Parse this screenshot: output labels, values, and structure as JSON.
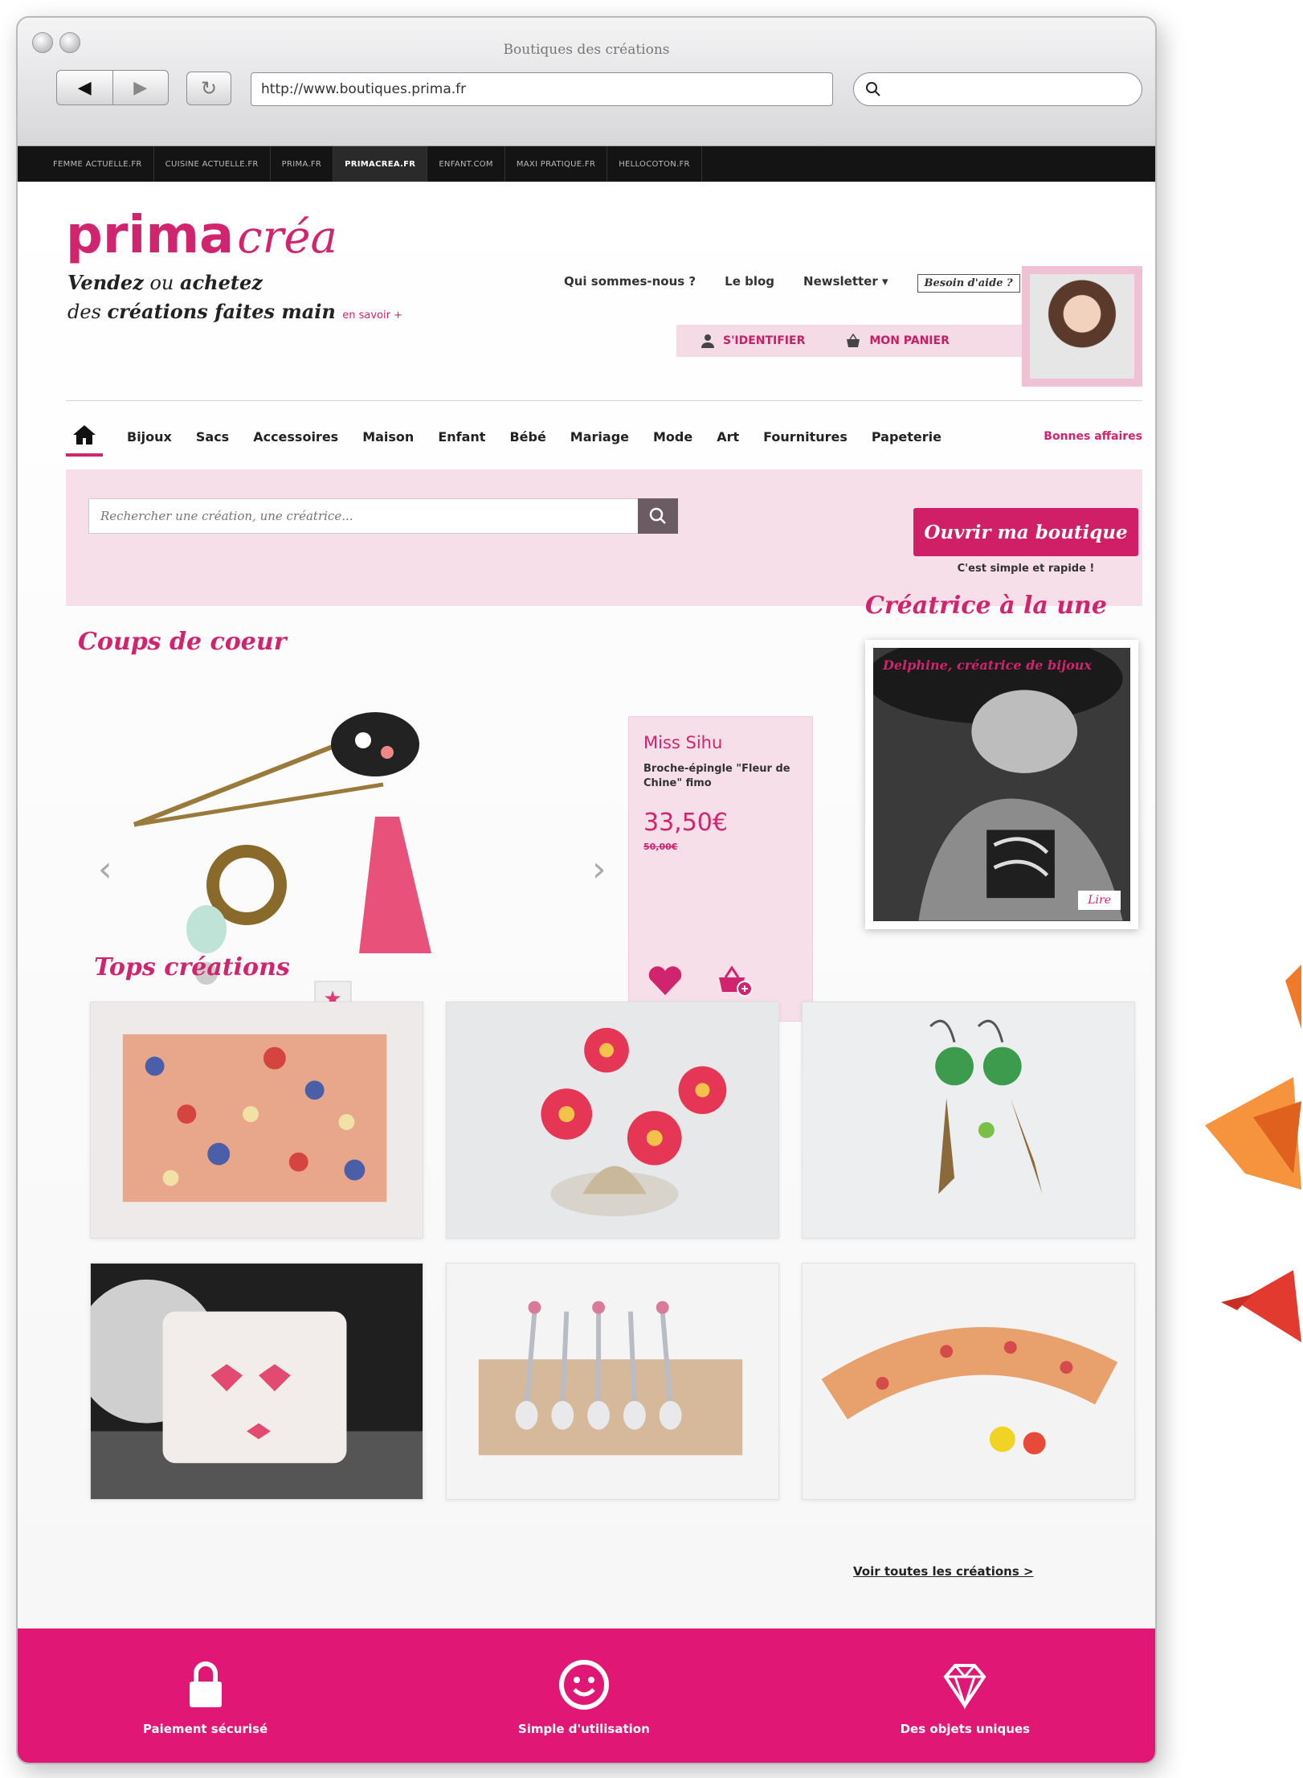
{
  "browser": {
    "window_title": "Boutiques des créations",
    "url": "http://www.boutiques.prima.fr",
    "back_icon": "back-arrow-icon",
    "forward_icon": "forward-arrow-icon",
    "reload_icon": "reload-icon",
    "search_icon": "search-icon"
  },
  "network_bar": {
    "items": [
      "FEMME ACTUELLE.FR",
      "CUISINE ACTUELLE.FR",
      "PRIMA.FR",
      "PRIMACREA.FR",
      "ENFANT.COM",
      "MAXI PRATIQUE.FR",
      "HELLOCOTON.FR"
    ],
    "active": "PRIMACREA.FR"
  },
  "header": {
    "logo_prima": "prima",
    "logo_crea": "créa",
    "tagline_strong1": "Vendez",
    "tagline_mid1": " ou ",
    "tagline_strong2": "achetez",
    "tagline_mid2": "des ",
    "tagline_strong3": "créations faites main",
    "tagline_more": "en savoir +",
    "links": [
      "Qui sommes-nous ?",
      "Le blog",
      "Newsletter ▾"
    ],
    "help": "Besoin d'aide ?",
    "login": "S'IDENTIFIER",
    "cart": "MON PANIER"
  },
  "nav": {
    "categories": [
      "Bijoux",
      "Sacs",
      "Accessoires",
      "Maison",
      "Enfant",
      "Bébé",
      "Mariage",
      "Mode",
      "Art",
      "Fournitures",
      "Papeterie"
    ],
    "deals": "Bonnes affaires"
  },
  "search": {
    "placeholder": "Rechercher une création, une créatrice...",
    "open_shop": "Ouvrir ma boutique",
    "open_shop_sub": "C'est simple et rapide !"
  },
  "coups_de_coeur": {
    "title": "Coups de coeur",
    "product": {
      "seller": "Miss Sihu",
      "name": "Broche-épingle \"Fleur de Chine\" fimo",
      "price": "33,50€",
      "old_price": "50,00€"
    },
    "slides": 3,
    "active_slide": 1
  },
  "creatrice": {
    "title": "Créatrice à la une",
    "caption": "Delphine, créatrice de bijoux",
    "read": "Lire"
  },
  "tops": {
    "title": "Tops créations",
    "see_all": "Voir toutes les créations >"
  },
  "footer": {
    "items": [
      {
        "label": "Paiement sécurisé",
        "icon": "lock-icon"
      },
      {
        "label": "Simple d'utilisation",
        "icon": "smiley-icon"
      },
      {
        "label": "Des objets uniques",
        "icon": "diamond-icon"
      }
    ]
  },
  "colors": {
    "accent": "#d1246f",
    "footer": "#e01774",
    "band": "#f6dfe8"
  }
}
